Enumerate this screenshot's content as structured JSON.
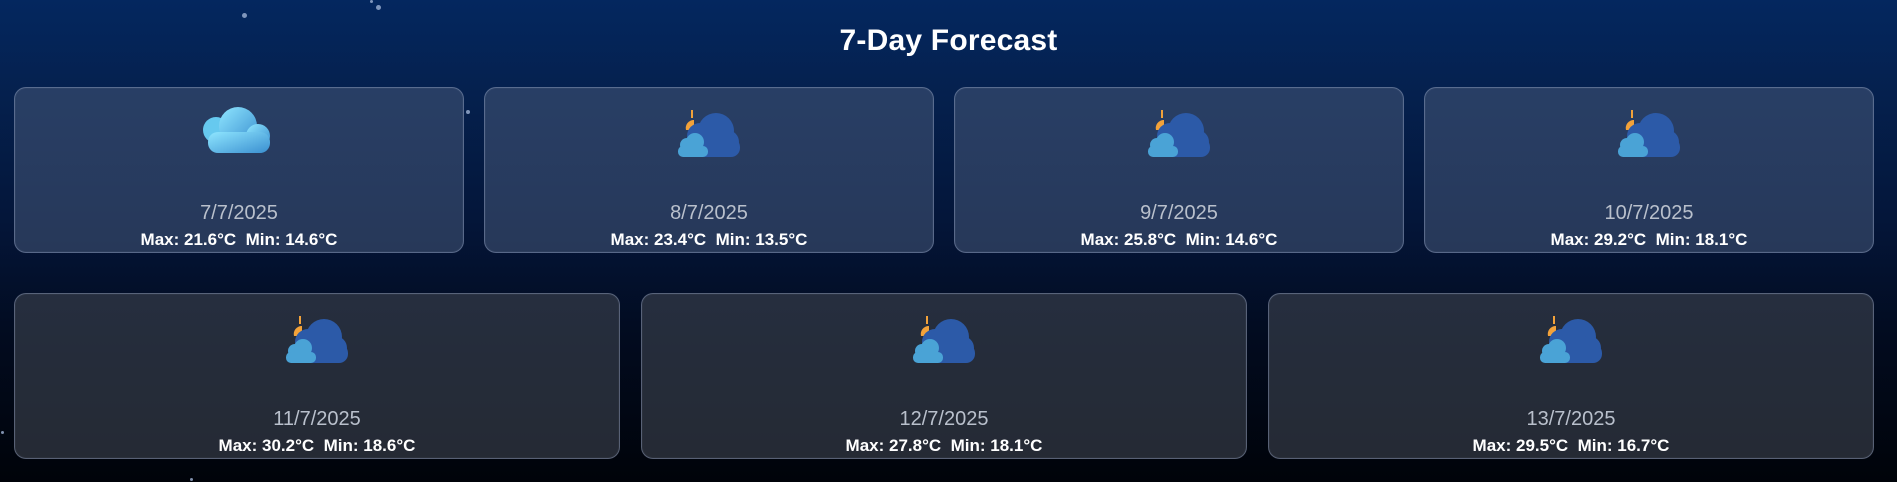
{
  "title": "7-Day Forecast",
  "days": [
    {
      "date": "7/7/2025",
      "max": "Max: 21.6°C",
      "min": "Min: 14.6°C",
      "icon": "cloud-rain-icon"
    },
    {
      "date": "8/7/2025",
      "max": "Max: 23.4°C",
      "min": "Min: 13.5°C",
      "icon": "partly-cloudy-icon"
    },
    {
      "date": "9/7/2025",
      "max": "Max: 25.8°C",
      "min": "Min: 14.6°C",
      "icon": "partly-cloudy-icon"
    },
    {
      "date": "10/7/2025",
      "max": "Max: 29.2°C",
      "min": "Min: 18.1°C",
      "icon": "partly-cloudy-icon"
    },
    {
      "date": "11/7/2025",
      "max": "Max: 30.2°C",
      "min": "Min: 18.6°C",
      "icon": "partly-cloudy-icon"
    },
    {
      "date": "12/7/2025",
      "max": "Max: 27.8°C",
      "min": "Min: 18.1°C",
      "icon": "partly-cloudy-icon"
    },
    {
      "date": "13/7/2025",
      "max": "Max: 29.5°C",
      "min": "Min: 16.7°C",
      "icon": "partly-cloudy-icon"
    }
  ],
  "colors": {
    "cloud_light": "#7fdcff",
    "cloud_dark": "#2c5aa8",
    "cloud_small": "#4aa3d6",
    "sun": "#f2a23a",
    "title": "#ffffff",
    "date": "#b9c0cc"
  }
}
